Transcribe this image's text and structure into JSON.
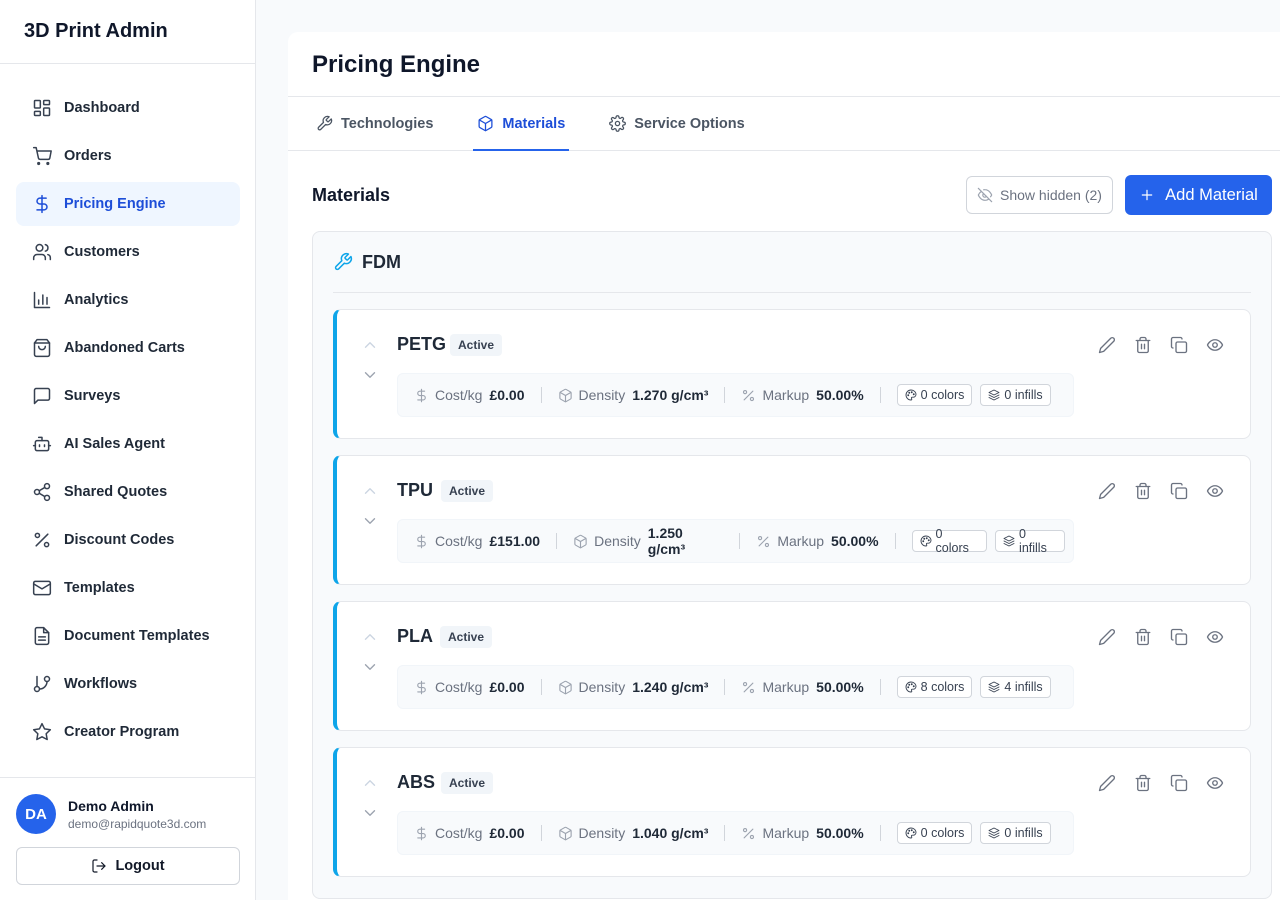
{
  "app": {
    "title": "3D Print Admin"
  },
  "sidebar": {
    "items": [
      {
        "label": "Dashboard",
        "icon": "dashboard-icon"
      },
      {
        "label": "Orders",
        "icon": "cart-icon"
      },
      {
        "label": "Pricing Engine",
        "icon": "dollar-icon",
        "active": true
      },
      {
        "label": "Customers",
        "icon": "users-icon"
      },
      {
        "label": "Analytics",
        "icon": "chart-icon"
      },
      {
        "label": "Abandoned Carts",
        "icon": "bag-icon"
      },
      {
        "label": "Surveys",
        "icon": "message-icon"
      },
      {
        "label": "AI Sales Agent",
        "icon": "bot-icon"
      },
      {
        "label": "Shared Quotes",
        "icon": "share-icon"
      },
      {
        "label": "Discount Codes",
        "icon": "percent-icon"
      },
      {
        "label": "Templates",
        "icon": "mail-icon"
      },
      {
        "label": "Document Templates",
        "icon": "file-icon"
      },
      {
        "label": "Workflows",
        "icon": "git-branch-icon"
      },
      {
        "label": "Creator Program",
        "icon": "star-icon"
      }
    ]
  },
  "user": {
    "initials": "DA",
    "name": "Demo Admin",
    "email": "demo@rapidquote3d.com",
    "logout_label": "Logout"
  },
  "page": {
    "title": "Pricing Engine"
  },
  "tabs": [
    {
      "label": "Technologies",
      "icon": "wrench-icon"
    },
    {
      "label": "Materials",
      "icon": "box-icon",
      "active": true
    },
    {
      "label": "Service Options",
      "icon": "gear-icon"
    }
  ],
  "section": {
    "title": "Materials",
    "show_hidden_label": "Show hidden (2)",
    "add_label": "Add Material"
  },
  "group": {
    "name": "FDM",
    "materials": [
      {
        "name": "PETG",
        "status": "Active",
        "cost_label": "Cost/kg",
        "cost": "£0.00",
        "density_label": "Density",
        "density": "1.270 g/cm³",
        "markup_label": "Markup",
        "markup": "50.00%",
        "colors": "0 colors",
        "infills": "0 infills"
      },
      {
        "name": "TPU",
        "status": "Active",
        "cost_label": "Cost/kg",
        "cost": "£151.00",
        "density_label": "Density",
        "density": "1.250 g/cm³",
        "markup_label": "Markup",
        "markup": "50.00%",
        "colors": "0 colors",
        "infills": "0 infills"
      },
      {
        "name": "PLA",
        "status": "Active",
        "cost_label": "Cost/kg",
        "cost": "£0.00",
        "density_label": "Density",
        "density": "1.240 g/cm³",
        "markup_label": "Markup",
        "markup": "50.00%",
        "colors": "8 colors",
        "infills": "4 infills"
      },
      {
        "name": "ABS",
        "status": "Active",
        "cost_label": "Cost/kg",
        "cost": "£0.00",
        "density_label": "Density",
        "density": "1.040 g/cm³",
        "markup_label": "Markup",
        "markup": "50.00%",
        "colors": "0 colors",
        "infills": "0 infills"
      }
    ]
  },
  "colors": {
    "accent": "#2563eb",
    "material_border": "#0ea5e9"
  }
}
